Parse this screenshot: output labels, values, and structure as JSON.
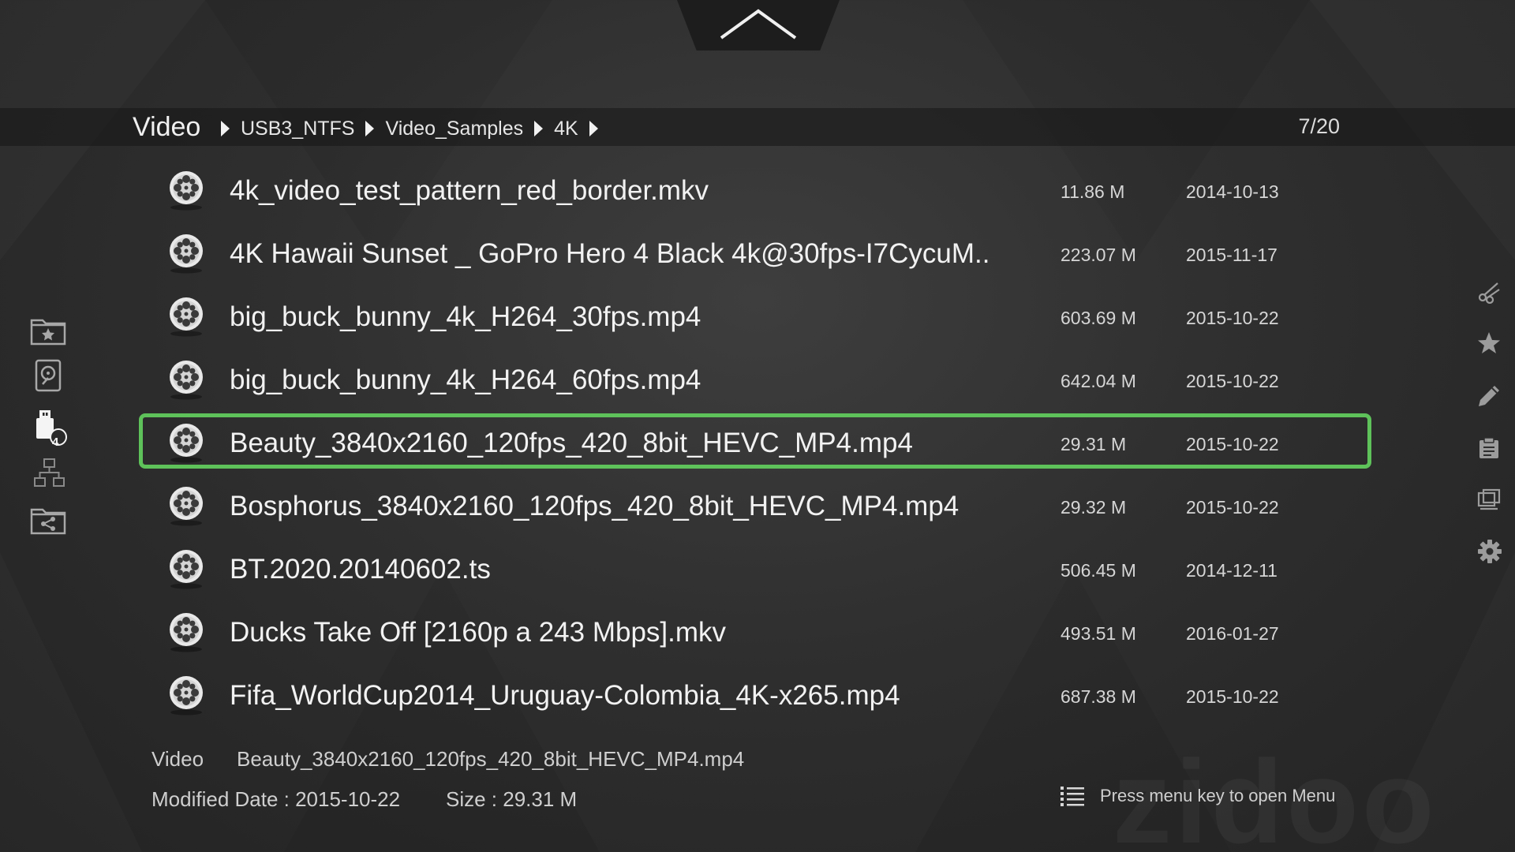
{
  "breadcrumb": {
    "root": "Video",
    "segments": [
      "USB3_NTFS",
      "Video_Samples",
      "4K"
    ]
  },
  "page_counter": "7/20",
  "files": [
    {
      "name": "4k_video_test_pattern_red_border.mkv",
      "size": "11.86 M",
      "date": "2014-10-13"
    },
    {
      "name": "4K Hawaii Sunset _ GoPro Hero 4 Black 4k@30fps-I7CycuM..",
      "size": "223.07 M",
      "date": "2015-11-17"
    },
    {
      "name": "big_buck_bunny_4k_H264_30fps.mp4",
      "size": "603.69 M",
      "date": "2015-10-22"
    },
    {
      "name": "big_buck_bunny_4k_H264_60fps.mp4",
      "size": "642.04 M",
      "date": "2015-10-22"
    },
    {
      "name": "Beauty_3840x2160_120fps_420_8bit_HEVC_MP4.mp4",
      "size": "29.31 M",
      "date": "2015-10-22",
      "selected": true
    },
    {
      "name": "Bosphorus_3840x2160_120fps_420_8bit_HEVC_MP4.mp4",
      "size": "29.32 M",
      "date": "2015-10-22"
    },
    {
      "name": "BT.2020.20140602.ts",
      "size": "506.45 M",
      "date": "2014-12-11"
    },
    {
      "name": "Ducks Take Off [2160p a 243 Mbps].mkv",
      "size": "493.51 M",
      "date": "2016-01-27"
    },
    {
      "name": "Fifa_WorldCup2014_Uruguay-Colombia_4K-x265.mp4",
      "size": "687.38 M",
      "date": "2015-10-22"
    }
  ],
  "left_nav": [
    {
      "icon": "favorite-folder-icon"
    },
    {
      "icon": "local-disk-icon"
    },
    {
      "icon": "usb-drive-icon",
      "badge": "4",
      "active": true
    },
    {
      "icon": "network-icon"
    },
    {
      "icon": "network-share-folder-icon"
    }
  ],
  "right_tools": [
    {
      "icon": "scissors-icon"
    },
    {
      "icon": "star-icon"
    },
    {
      "icon": "pencil-icon"
    },
    {
      "icon": "clipboard-icon"
    },
    {
      "icon": "view-mode-icon"
    },
    {
      "icon": "gear-icon"
    }
  ],
  "info": {
    "type_label": "Video",
    "file_name": "Beauty_3840x2160_120fps_420_8bit_HEVC_MP4.mp4",
    "modified": "Modified Date : 2015-10-22",
    "size": "Size : 29.31 M"
  },
  "menu_hint": "Press menu key to open Menu",
  "watermark": "zidoo",
  "colors": {
    "selection_border": "#5ec25a",
    "background": "#2f2f2f",
    "text": "#f2f2f2"
  }
}
